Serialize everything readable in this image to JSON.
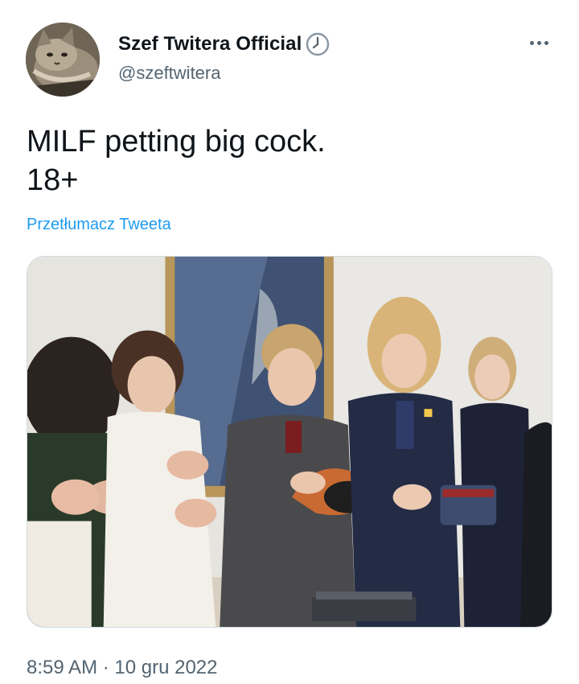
{
  "author": {
    "name": "Szef Twitera Official",
    "handle": "@szeftwitera",
    "badge_icon": "clock-icon",
    "avatar_icon": "cat-avatar"
  },
  "tweet": {
    "text_line1": "MILF petting big cock.",
    "text_line2": "18+",
    "translate_label": "Przetłumacz Tweeta",
    "timestamp": "8:59 AM · 10 gru 2022"
  },
  "actions": {
    "more_icon": "more-dots-icon"
  },
  "colors": {
    "link": "#1d9bf0",
    "secondary_text": "#536471",
    "primary_text": "#0f1419"
  }
}
